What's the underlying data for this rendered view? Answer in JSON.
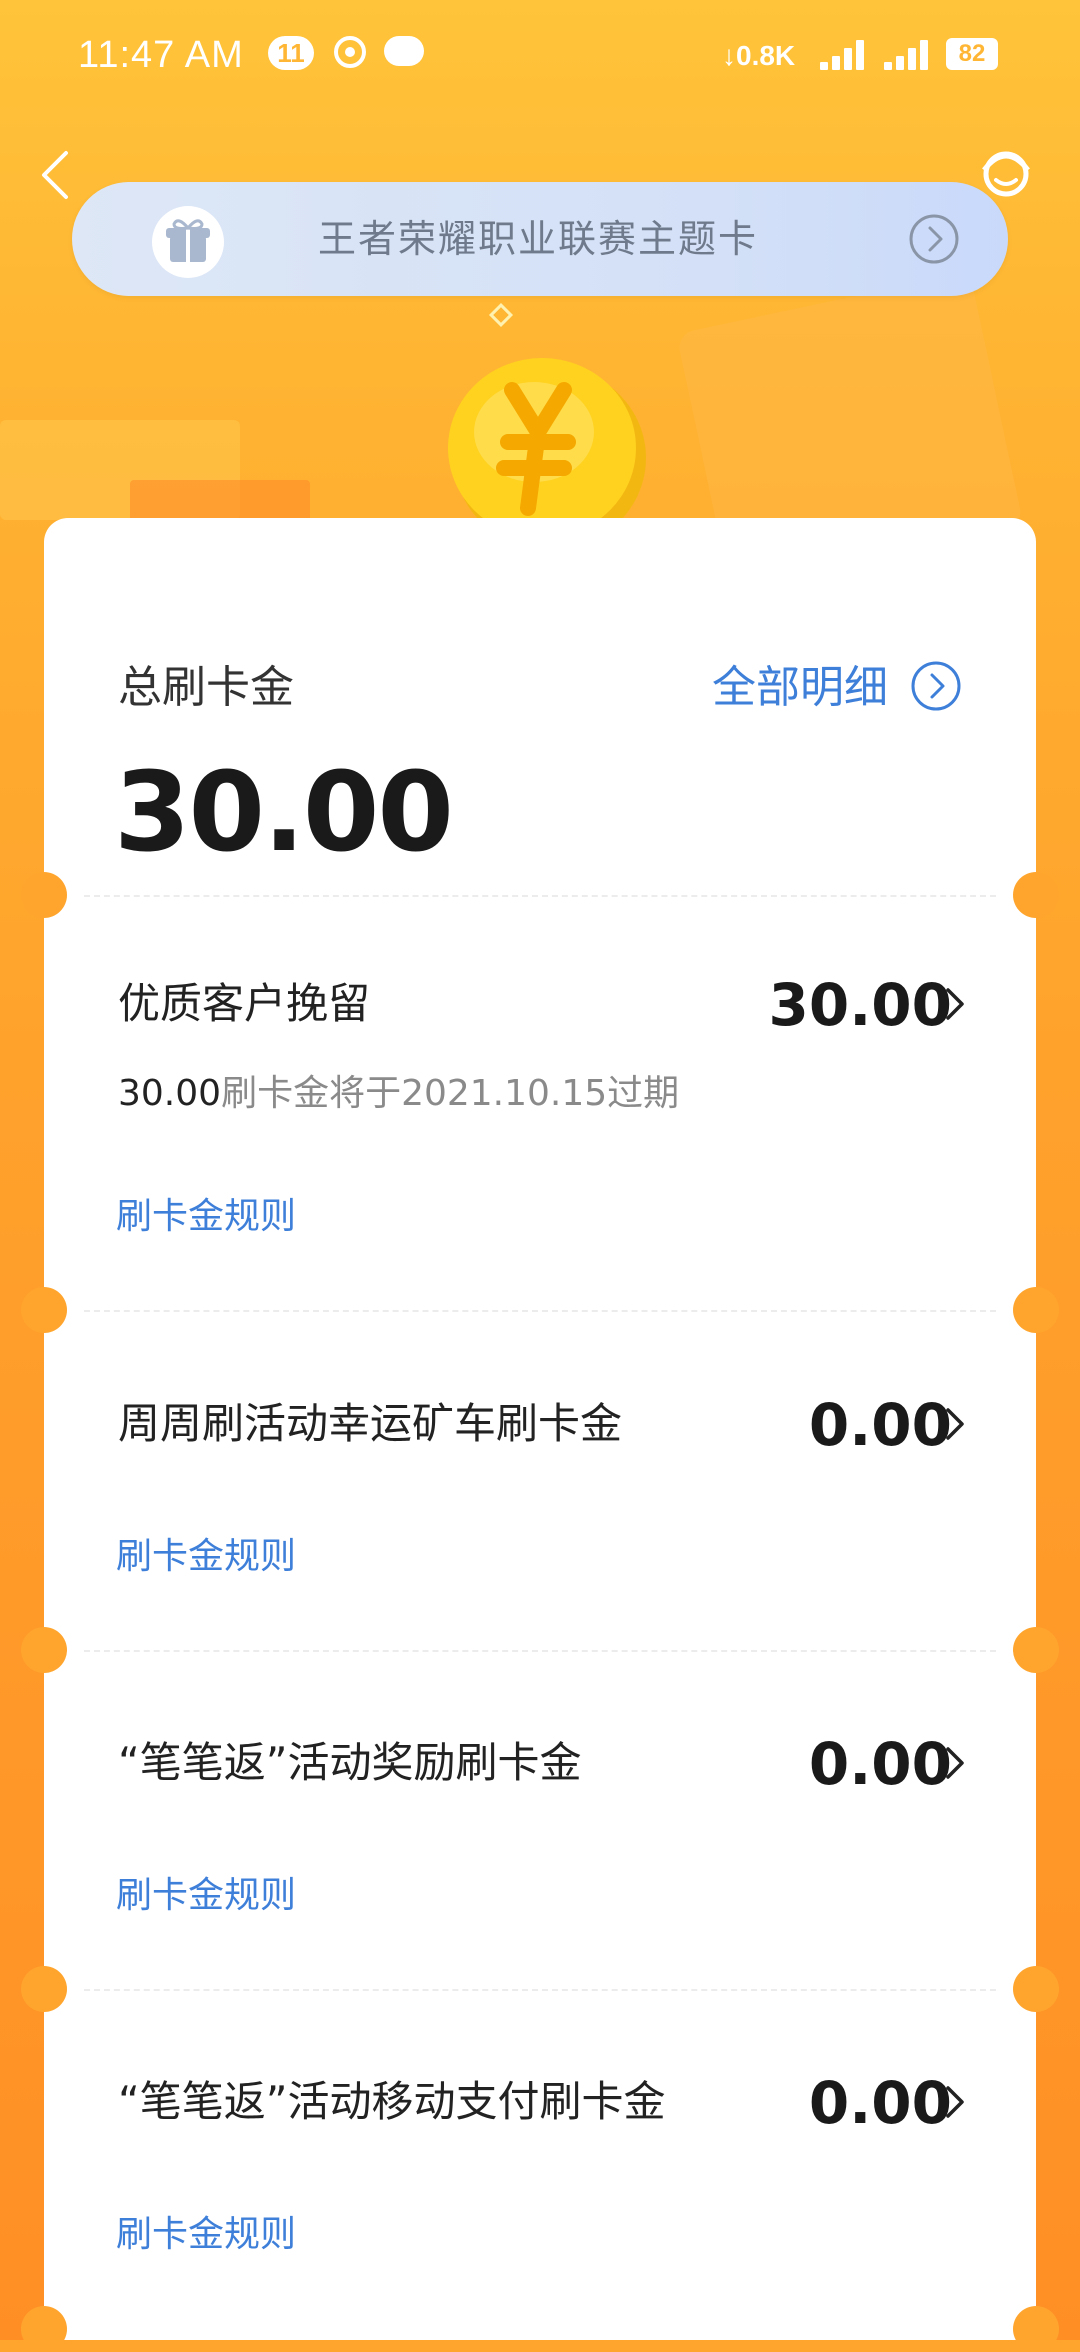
{
  "status_bar": {
    "time": "11:47 AM",
    "notification_count": "11",
    "net_speed": "0.8K",
    "battery": "82"
  },
  "banner": {
    "text": "王者荣耀职业联赛主题卡"
  },
  "summary": {
    "label": "总刷卡金",
    "amount": "30.00",
    "detail_link": "全部明细"
  },
  "items": [
    {
      "title": "优质客户挽留",
      "amount": "30.00",
      "expire_amount": "30.00",
      "expire_text": "刷卡金将于2021.10.15过期",
      "rule_link": "刷卡金规则"
    },
    {
      "title": "周周刷活动幸运矿车刷卡金",
      "amount": "0.00",
      "rule_link": "刷卡金规则"
    },
    {
      "title": "“笔笔返”活动奖励刷卡金",
      "amount": "0.00",
      "rule_link": "刷卡金规则"
    },
    {
      "title": "“笔笔返”活动移动支付刷卡金",
      "amount": "0.00",
      "rule_link": "刷卡金规则"
    }
  ],
  "colors": {
    "accent_blue": "#3E7FD9",
    "background_orange": "#FFA52E",
    "coin_yellow": "#FFD21F"
  }
}
